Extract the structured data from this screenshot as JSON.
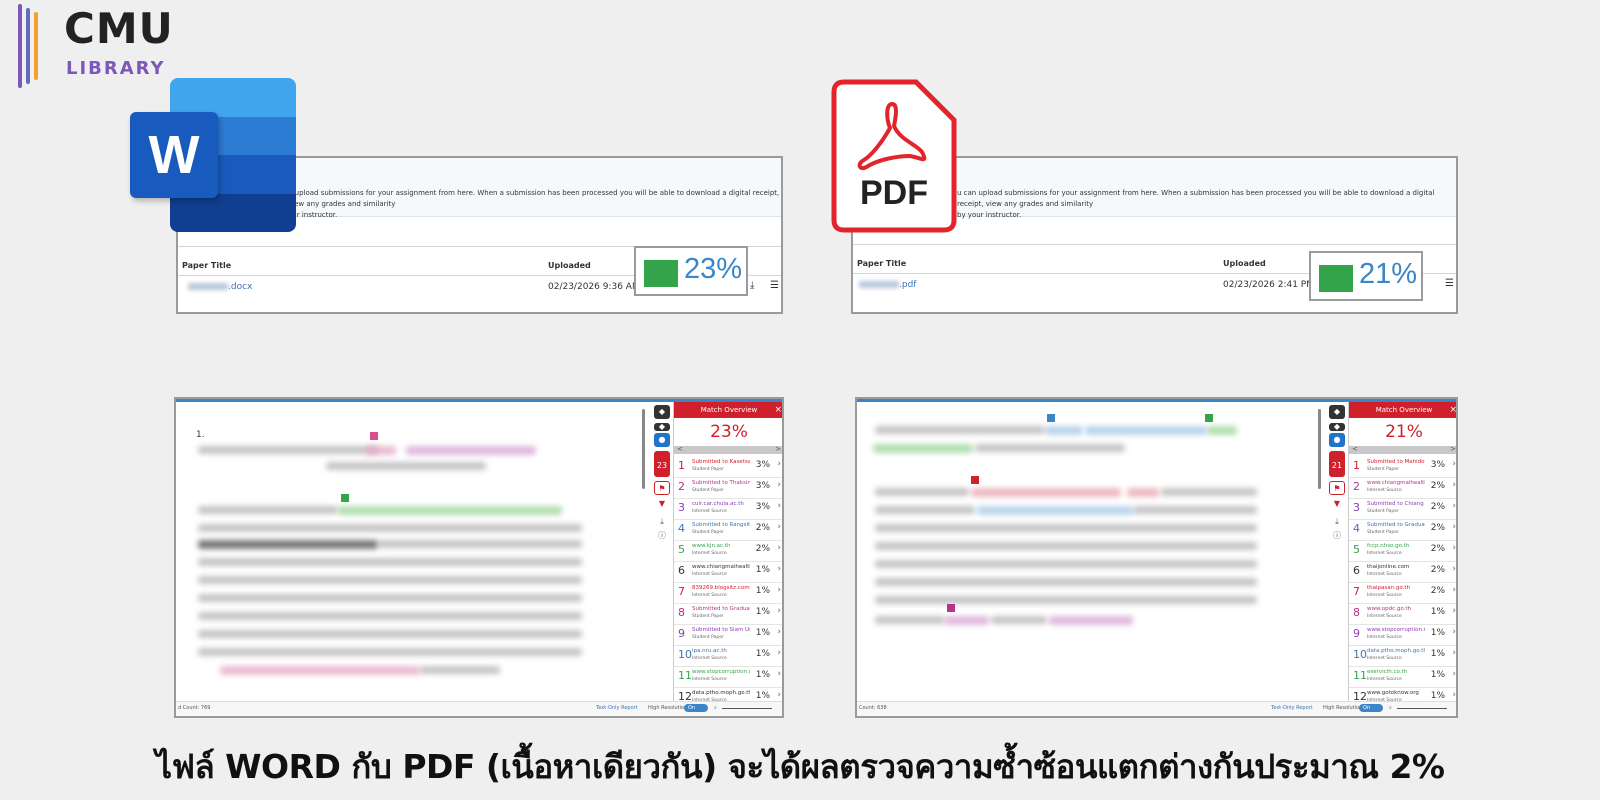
{
  "logo": {
    "brand": "CMU",
    "subtitle": "LIBRARY",
    "bar_colors": [
      "#7d57b9",
      "#5f6dbf",
      "#f2a22c"
    ]
  },
  "word_panel": {
    "icon_letter": "W",
    "intro_text_line1": "n upload submissions for your assignment from here. When a submission has been processed you will be able to download a digital receipt, view any grades and similarity",
    "intro_text_line2": "our instructor.",
    "col_title": "Paper Title",
    "col_uploaded": "Uploaded",
    "file_name": ".docx",
    "uploaded_date": "02/23/2026 9:36 AM",
    "similarity": "23%",
    "similarity_color": "#33a44a"
  },
  "pdf_panel": {
    "icon_label": "PDF",
    "intro_text_line1": "u can upload submissions for your assignment from here. When a submission has been processed you will be able to download a digital receipt, view any grades and similarity",
    "intro_text_line2": "by your instructor.",
    "col_title": "Paper Title",
    "col_uploaded": "Uploaded",
    "file_name": ".pdf",
    "uploaded_date": "02/23/2026 2:41 PM",
    "similarity": "21%",
    "similarity_color": "#33a44a"
  },
  "word_viewer": {
    "doc_number": "1.",
    "match_title": "Match Overview",
    "match_total": "23%",
    "tool_count": "23",
    "sources": [
      {
        "num": "1",
        "name": "Submitted to Kasetsart...",
        "type": "Student Paper",
        "pct": "3%",
        "color": "#d0202b"
      },
      {
        "num": "2",
        "name": "Submitted to Thaksin U...",
        "type": "Student Paper",
        "pct": "3%",
        "color": "#b5338a"
      },
      {
        "num": "3",
        "name": "cuir.car.chula.ac.th",
        "type": "Internet Source",
        "pct": "3%",
        "color": "#8a3db5"
      },
      {
        "num": "4",
        "name": "Submitted to Rangsit U...",
        "type": "Student Paper",
        "pct": "2%",
        "color": "#3b73b9"
      },
      {
        "num": "5",
        "name": "www.kjn.ac.th",
        "type": "Internet Source",
        "pct": "2%",
        "color": "#33a44a"
      },
      {
        "num": "6",
        "name": "www.chiangmaihealth....",
        "type": "Internet Source",
        "pct": "1%",
        "color": "#333333"
      },
      {
        "num": "7",
        "name": "839269.blogsitz.com",
        "type": "Internet Source",
        "pct": "1%",
        "color": "#d0202b"
      },
      {
        "num": "8",
        "name": "Submitted to Graduate...",
        "type": "Student Paper",
        "pct": "1%",
        "color": "#b5338a"
      },
      {
        "num": "9",
        "name": "Submitted to Siam Univ...",
        "type": "Student Paper",
        "pct": "1%",
        "color": "#8a3db5"
      },
      {
        "num": "10",
        "name": "ipa.nru.ac.th",
        "type": "Internet Source",
        "pct": "1%",
        "color": "#3b73b9"
      },
      {
        "num": "11",
        "name": "www.stopcorruption.m...",
        "type": "Internet Source",
        "pct": "1%",
        "color": "#33a44a"
      },
      {
        "num": "12",
        "name": "data.ptho.moph.go.th",
        "type": "Internet Source",
        "pct": "1%",
        "color": "#333333"
      }
    ],
    "word_count": "d Count: 769",
    "text_only": "Text-Only Report",
    "high_res": "High Resolution",
    "toggle": "On"
  },
  "pdf_viewer": {
    "match_title": "Match Overview",
    "match_total": "21%",
    "tool_count": "21",
    "sources": [
      {
        "num": "1",
        "name": "Submitted to Mahidol ...",
        "type": "Student Paper",
        "pct": "3%",
        "color": "#d0202b"
      },
      {
        "num": "2",
        "name": "www.chiangmaihealth...",
        "type": "Internet Source",
        "pct": "2%",
        "color": "#b5338a"
      },
      {
        "num": "3",
        "name": "Submitted to Chiang M...",
        "type": "Student Paper",
        "pct": "2%",
        "color": "#8a3db5"
      },
      {
        "num": "4",
        "name": "Submitted to Graduate ...",
        "type": "Student Paper",
        "pct": "2%",
        "color": "#3b73b9"
      },
      {
        "num": "5",
        "name": "fccp.nhso.go.th",
        "type": "Internet Source",
        "pct": "2%",
        "color": "#33a44a"
      },
      {
        "num": "6",
        "name": "thaijonline.com",
        "type": "Internet Source",
        "pct": "2%",
        "color": "#333333"
      },
      {
        "num": "7",
        "name": "thaipasan.go.th",
        "type": "Internet Source",
        "pct": "2%",
        "color": "#d0202b"
      },
      {
        "num": "8",
        "name": "www.opdc.go.th",
        "type": "Internet Source",
        "pct": "1%",
        "color": "#b5338a"
      },
      {
        "num": "9",
        "name": "www.stopcorruption.m...",
        "type": "Internet Source",
        "pct": "1%",
        "color": "#8a3db5"
      },
      {
        "num": "10",
        "name": "data.ptho.moph.go.th",
        "type": "Internet Source",
        "pct": "1%",
        "color": "#3b73b9"
      },
      {
        "num": "11",
        "name": "eservicih.co.th",
        "type": "Internet Source",
        "pct": "1%",
        "color": "#33a44a"
      },
      {
        "num": "12",
        "name": "www.gotoknow.org",
        "type": "Internet Source",
        "pct": "1%",
        "color": "#333333"
      }
    ],
    "word_count": "Count: 638",
    "text_only": "Text-Only Report",
    "high_res": "High Resolution",
    "toggle": "On"
  },
  "caption": "ไฟล์ WORD กับ PDF (เนื้อหาเดียวกัน) จะได้ผลตรวจความซ้ำซ้อนแตกต่างกันประมาณ 2%"
}
